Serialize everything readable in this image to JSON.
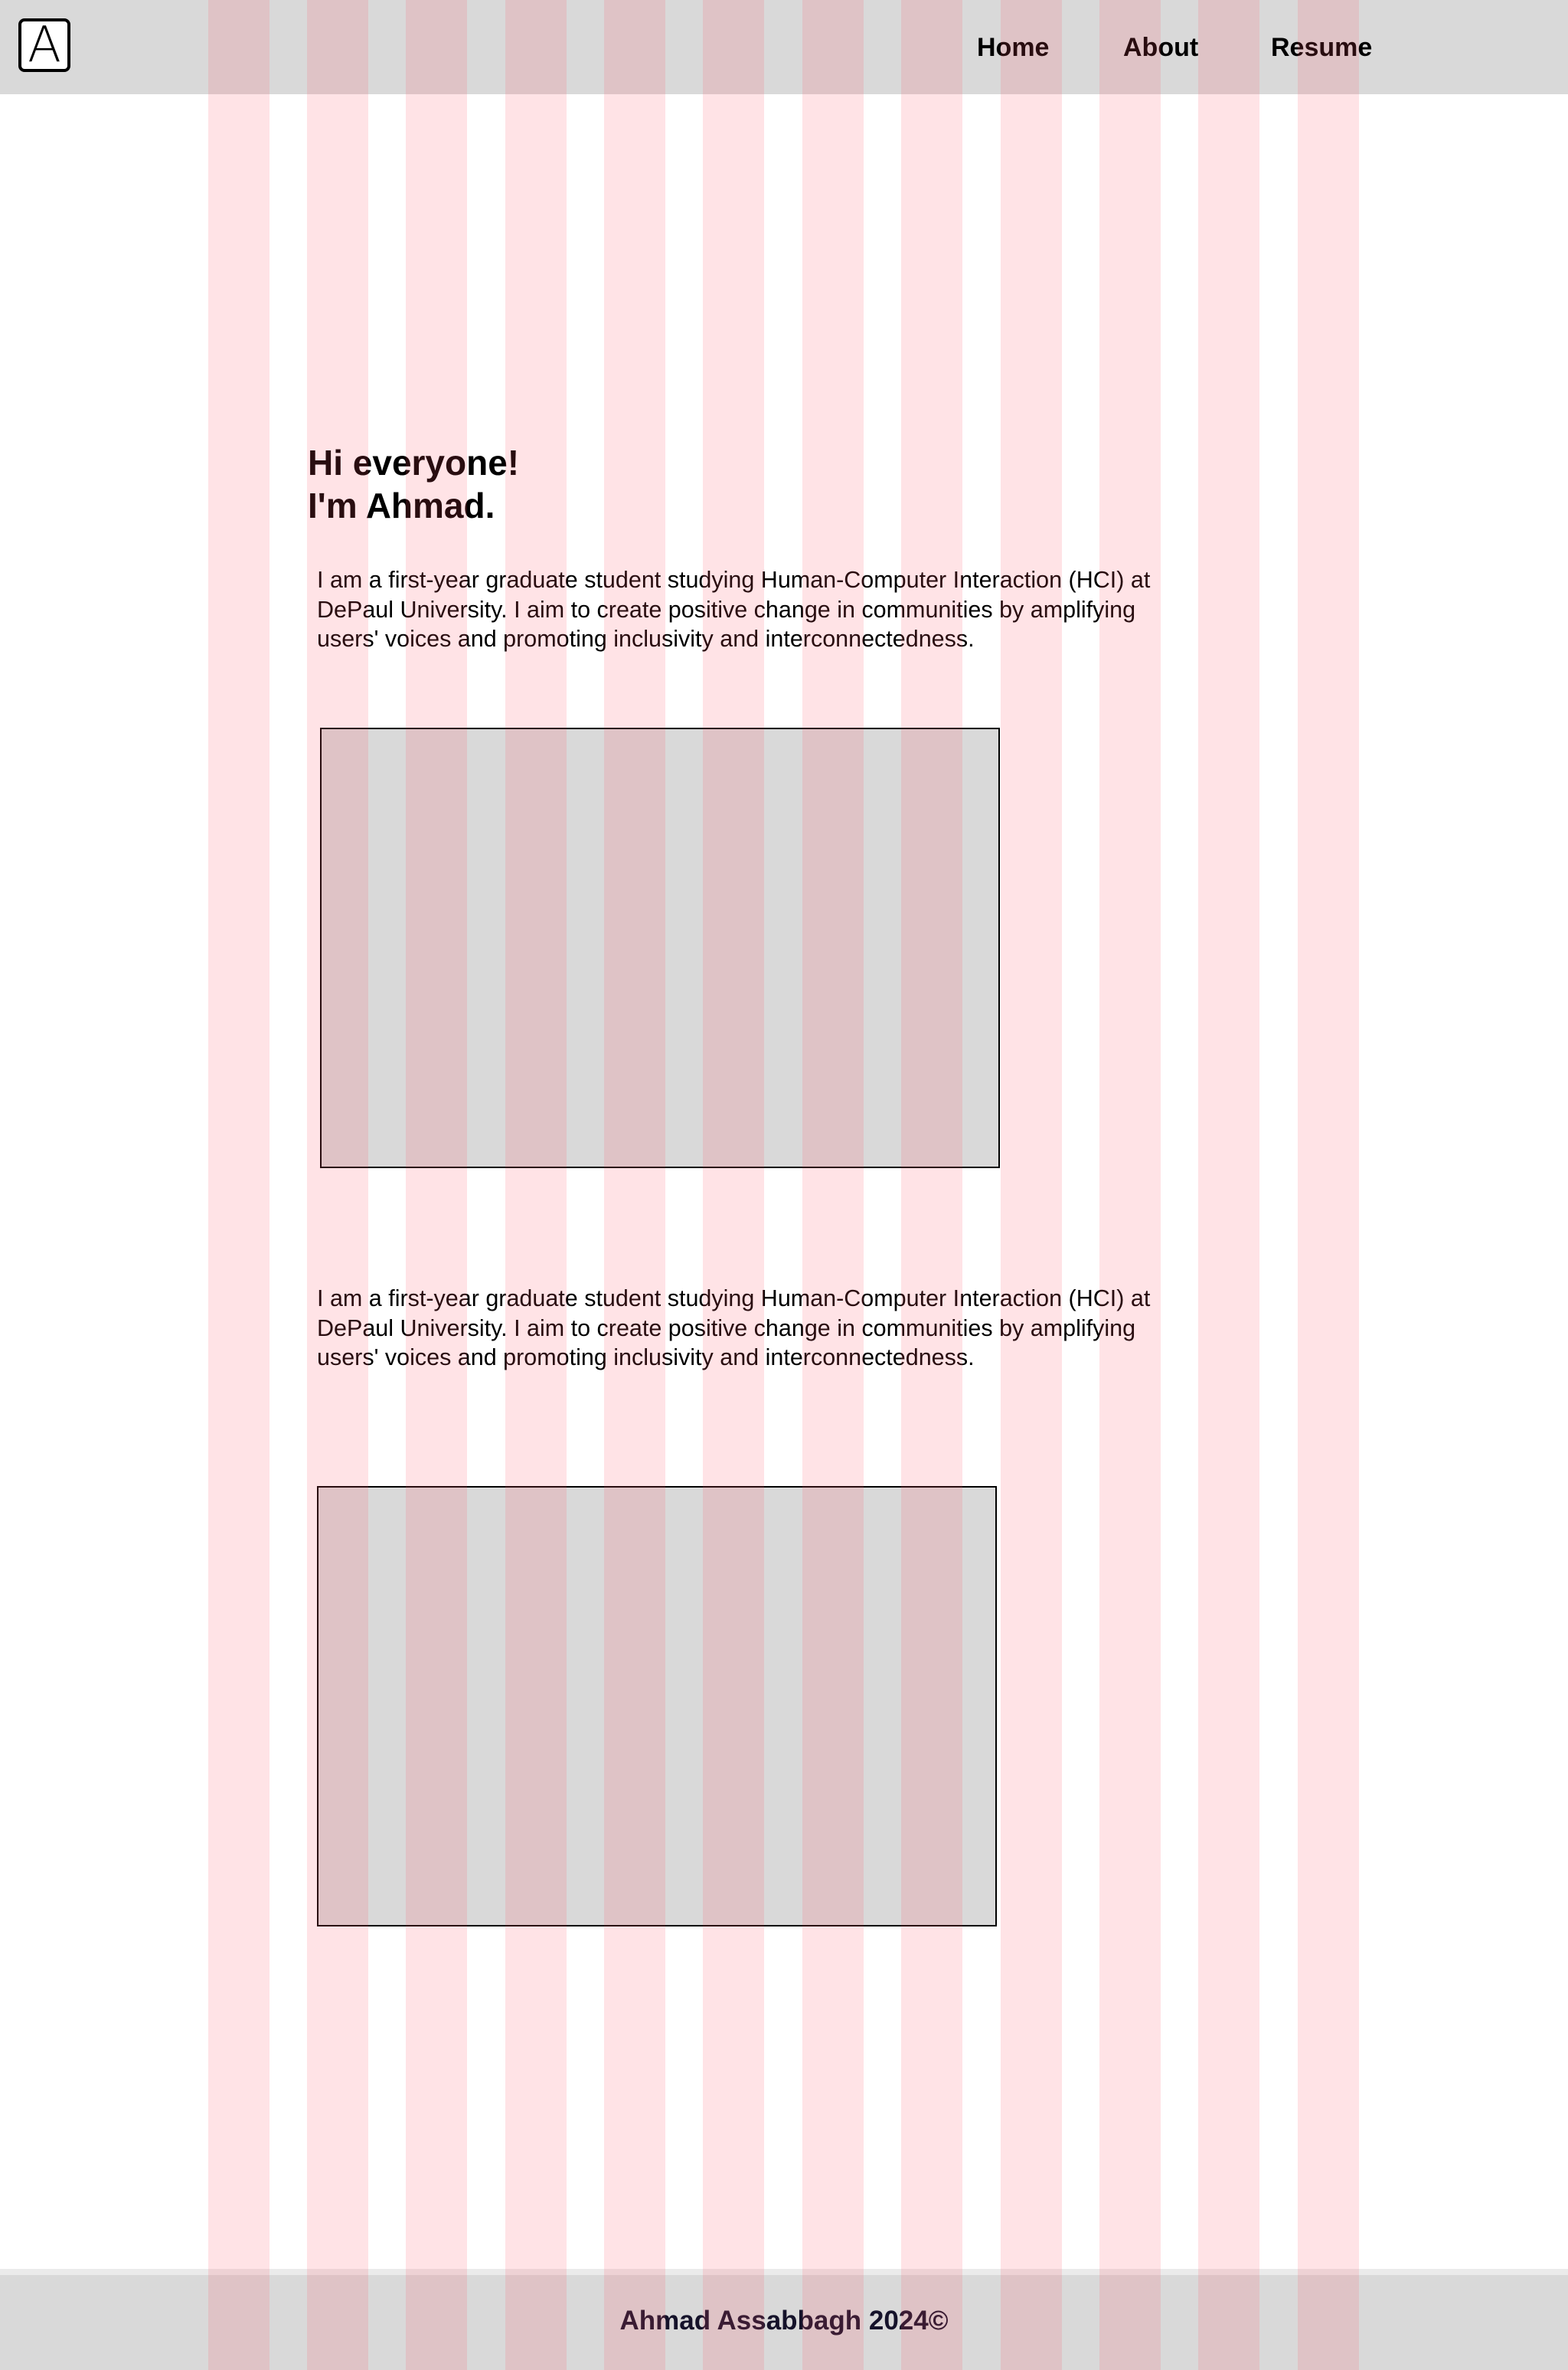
{
  "header": {
    "logo_letter": "A",
    "nav": {
      "home": "Home",
      "about": "About",
      "resume": "Resume"
    }
  },
  "hero": {
    "greeting": "Hi everyone!",
    "name_line": "I'm Ahmad."
  },
  "sections": [
    {
      "text": "I am a first-year graduate student studying Human-Computer Interaction (HCI) at DePaul University. I aim to create positive change in communities by amplifying users' voices and promoting inclusivity and interconnectedness."
    },
    {
      "text": "I am a first-year graduate student studying Human-Computer Interaction (HCI) at DePaul University. I aim to create positive change in communities by amplifying users' voices and promoting inclusivity and interconnectedness."
    }
  ],
  "footer": {
    "text": "Ahmad Assabbagh 2024©"
  },
  "colors": {
    "header_bg": "#d9d9d9",
    "placeholder_bg": "#d9d9d9",
    "grid_overlay": "#ff5266",
    "footer_text": "#15122a"
  }
}
